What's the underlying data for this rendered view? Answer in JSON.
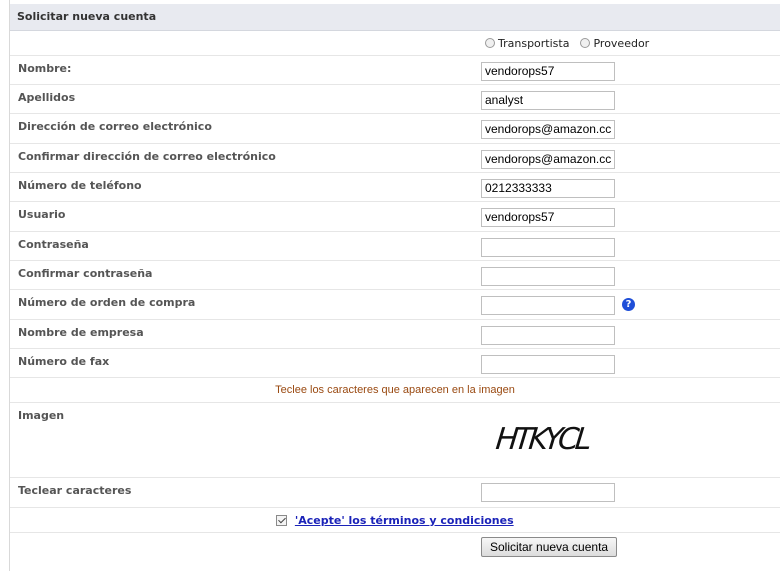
{
  "header": {
    "title": "Solicitar nueva cuenta"
  },
  "account_type": {
    "options": [
      "Transportista",
      "Proveedor"
    ]
  },
  "fields": {
    "nombre": {
      "label": "Nombre:",
      "value": "vendorops57"
    },
    "apellidos": {
      "label": "Apellidos",
      "value": "analyst"
    },
    "email": {
      "label": "Dirección de correo electrónico",
      "value": "vendorops@amazon.cc"
    },
    "email_confirm": {
      "label": "Confirmar dirección de correo electrónico",
      "value": "vendorops@amazon.cc"
    },
    "telefono": {
      "label": "Número de teléfono",
      "value": "0212333333"
    },
    "usuario": {
      "label": "Usuario",
      "value": "vendorops57"
    },
    "contrasena": {
      "label": "Contraseña",
      "value": ""
    },
    "contrasena_confirm": {
      "label": "Confirmar contraseña",
      "value": ""
    },
    "orden_compra": {
      "label": "Número de orden de compra",
      "value": ""
    },
    "empresa": {
      "label": "Nombre de empresa",
      "value": ""
    },
    "fax": {
      "label": "Número de fax",
      "value": ""
    }
  },
  "captcha": {
    "instruction": "Teclee los caracteres que aparecen en la imagen",
    "image_label": "Imagen",
    "image_text": "HTKYCL",
    "input_label": "Teclear caracteres",
    "input_value": ""
  },
  "terms": {
    "label": "'Acepte' los términos y condiciones",
    "checked": true
  },
  "submit": {
    "label": "Solicitar nueva cuenta"
  },
  "colors": {
    "header_bg": "#e8eaf0",
    "instruction_text": "#9a4a12",
    "link": "#1a22b8",
    "help_icon": "#1f4fd8"
  },
  "help_icon": "question-mark-circle-icon"
}
